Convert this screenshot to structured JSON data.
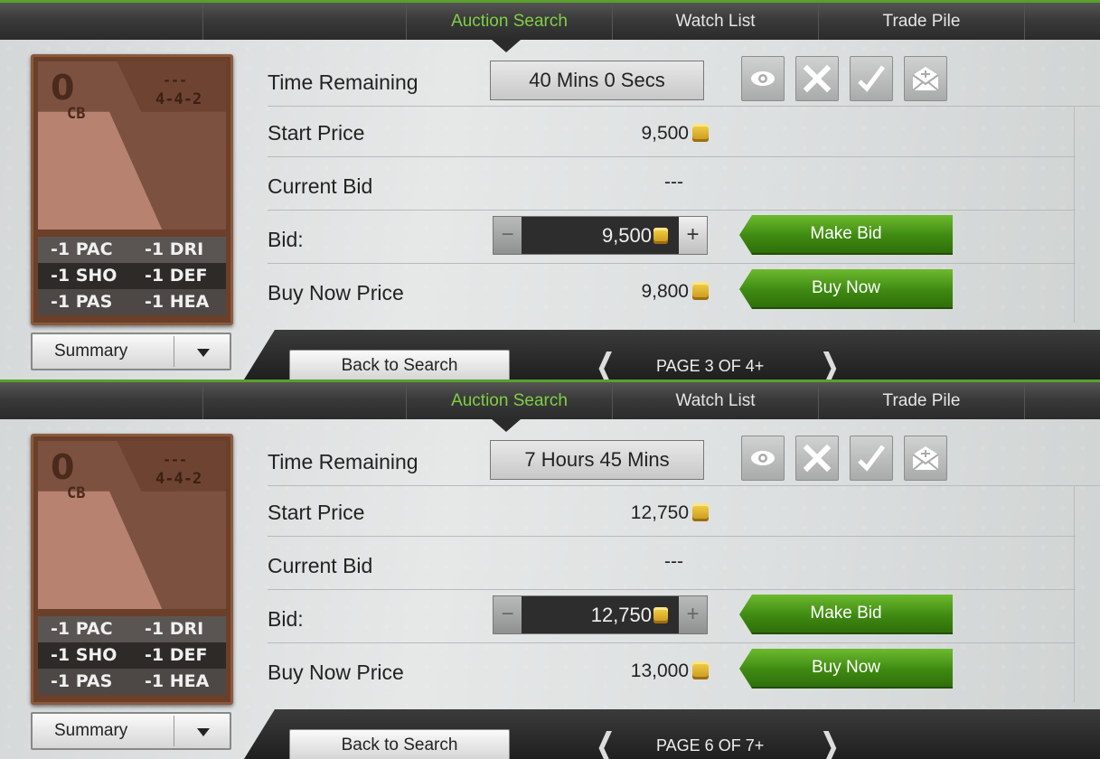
{
  "panels": [
    {
      "tabs": [
        "Auction Search",
        "Watch List",
        "Trade Pile"
      ],
      "active_tab": "Auction Search",
      "card": {
        "rating": "0",
        "position": "CB",
        "club_placeholder": "---",
        "formation": "4-4-2",
        "stats": [
          [
            "-1 PAC",
            "-1 DRI"
          ],
          [
            "-1 SHO",
            "-1 DEF"
          ],
          [
            "-1 PAS",
            "-1 HEA"
          ]
        ]
      },
      "summary_label": "Summary",
      "labels": {
        "time_remaining": "Time Remaining",
        "start_price": "Start Price",
        "current_bid": "Current Bid",
        "bid": "Bid:",
        "buy_now_price": "Buy Now Price"
      },
      "time_remaining": "40 Mins 0 Secs",
      "start_price": "9,500",
      "current_bid": "---",
      "bid_value": "9,500",
      "bid_minus": "−",
      "bid_plus": "+",
      "plus_enabled": true,
      "buy_now_price": "9,800",
      "make_bid_label": "Make Bid",
      "buy_now_label": "Buy Now",
      "back_label": "Back to Search",
      "page_text": "PAGE 3 OF 4+",
      "prev_arrow": "❮",
      "next_arrow": "❯"
    },
    {
      "tabs": [
        "Auction Search",
        "Watch List",
        "Trade Pile"
      ],
      "active_tab": "Auction Search",
      "card": {
        "rating": "0",
        "position": "CB",
        "club_placeholder": "---",
        "formation": "4-4-2",
        "stats": [
          [
            "-1 PAC",
            "-1 DRI"
          ],
          [
            "-1 SHO",
            "-1 DEF"
          ],
          [
            "-1 PAS",
            "-1 HEA"
          ]
        ]
      },
      "summary_label": "Summary",
      "labels": {
        "time_remaining": "Time Remaining",
        "start_price": "Start Price",
        "current_bid": "Current Bid",
        "bid": "Bid:",
        "buy_now_price": "Buy Now Price"
      },
      "time_remaining": "7 Hours 45 Mins",
      "start_price": "12,750",
      "current_bid": "---",
      "bid_value": "12,750",
      "bid_minus": "−",
      "bid_plus": "+",
      "plus_enabled": false,
      "buy_now_price": "13,000",
      "make_bid_label": "Make Bid",
      "buy_now_label": "Buy Now",
      "back_label": "Back to Search",
      "page_text": "PAGE 6 OF 7+",
      "prev_arrow": "❮",
      "next_arrow": "❯"
    }
  ],
  "icons": [
    "watch-eye-icon",
    "cancel-x-icon",
    "confirm-check-icon",
    "send-mail-icon",
    "coin-icon"
  ],
  "colors": {
    "accent_green": "#7fcf44",
    "button_green": "#3f8a12",
    "card_brown": "#6b3f2a"
  }
}
